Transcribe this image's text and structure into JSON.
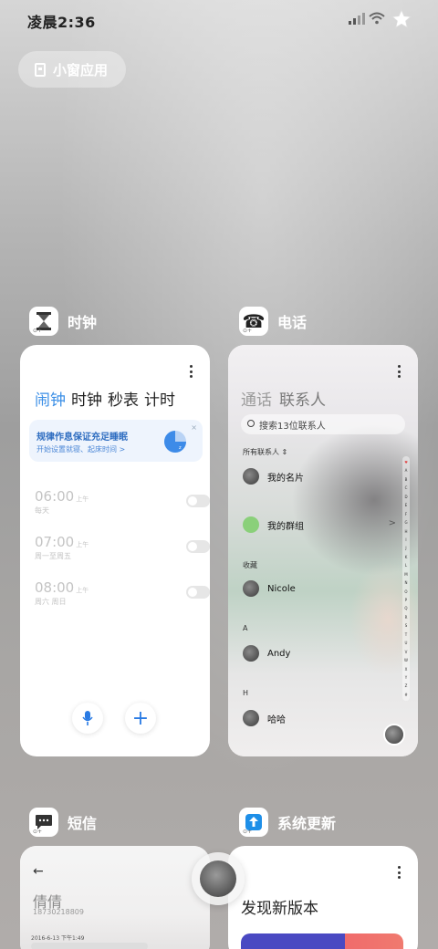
{
  "status_bar": {
    "time": "凌晨2:36"
  },
  "mini_app": {
    "label": "小窗应用"
  },
  "apps": {
    "clock": {
      "name": "时钟",
      "tabs": [
        "闹钟",
        "时钟",
        "秒表",
        "计时"
      ],
      "banner": {
        "title": "规律作息保证充足睡眠",
        "subtitle": "开始设置就寝、起床时间 >",
        "close": "×"
      },
      "alarms": [
        {
          "time": "06:00",
          "ampm": "上午",
          "repeat": "每天"
        },
        {
          "time": "07:00",
          "ampm": "上午",
          "repeat": "周一至周五"
        },
        {
          "time": "08:00",
          "ampm": "上午",
          "repeat": "周六 周日"
        }
      ],
      "add": "+"
    },
    "phone": {
      "name": "电话",
      "tabs": [
        "通话",
        "联系人"
      ],
      "search_placeholder": "搜索13位联系人",
      "all_contacts": "所有联系人 ⇕",
      "my_card": "我的名片",
      "my_groups": "我的群组",
      "chevron": ">",
      "sections": [
        {
          "label": "收藏",
          "name": "Nicole"
        },
        {
          "label": "A",
          "name": "Andy"
        },
        {
          "label": "H",
          "name": "哈哈"
        }
      ],
      "alphabet": [
        "♥",
        "A",
        "B",
        "C",
        "D",
        "E",
        "F",
        "G",
        "H",
        "I",
        "J",
        "K",
        "L",
        "M",
        "N",
        "O",
        "P",
        "Q",
        "R",
        "S",
        "T",
        "U",
        "V",
        "W",
        "X",
        "Y",
        "Z",
        "#"
      ]
    },
    "sms": {
      "name": "短信",
      "back": "←",
      "contact_name": "倩倩",
      "number": "18730218809",
      "date": "2016-6-13 下午1:49"
    },
    "update": {
      "name": "系统更新",
      "title": "发现新版本"
    }
  },
  "colors": {
    "accent": "#3a8ee6",
    "update_blue": "#4a49c2",
    "update_red": "#f06b6b"
  }
}
